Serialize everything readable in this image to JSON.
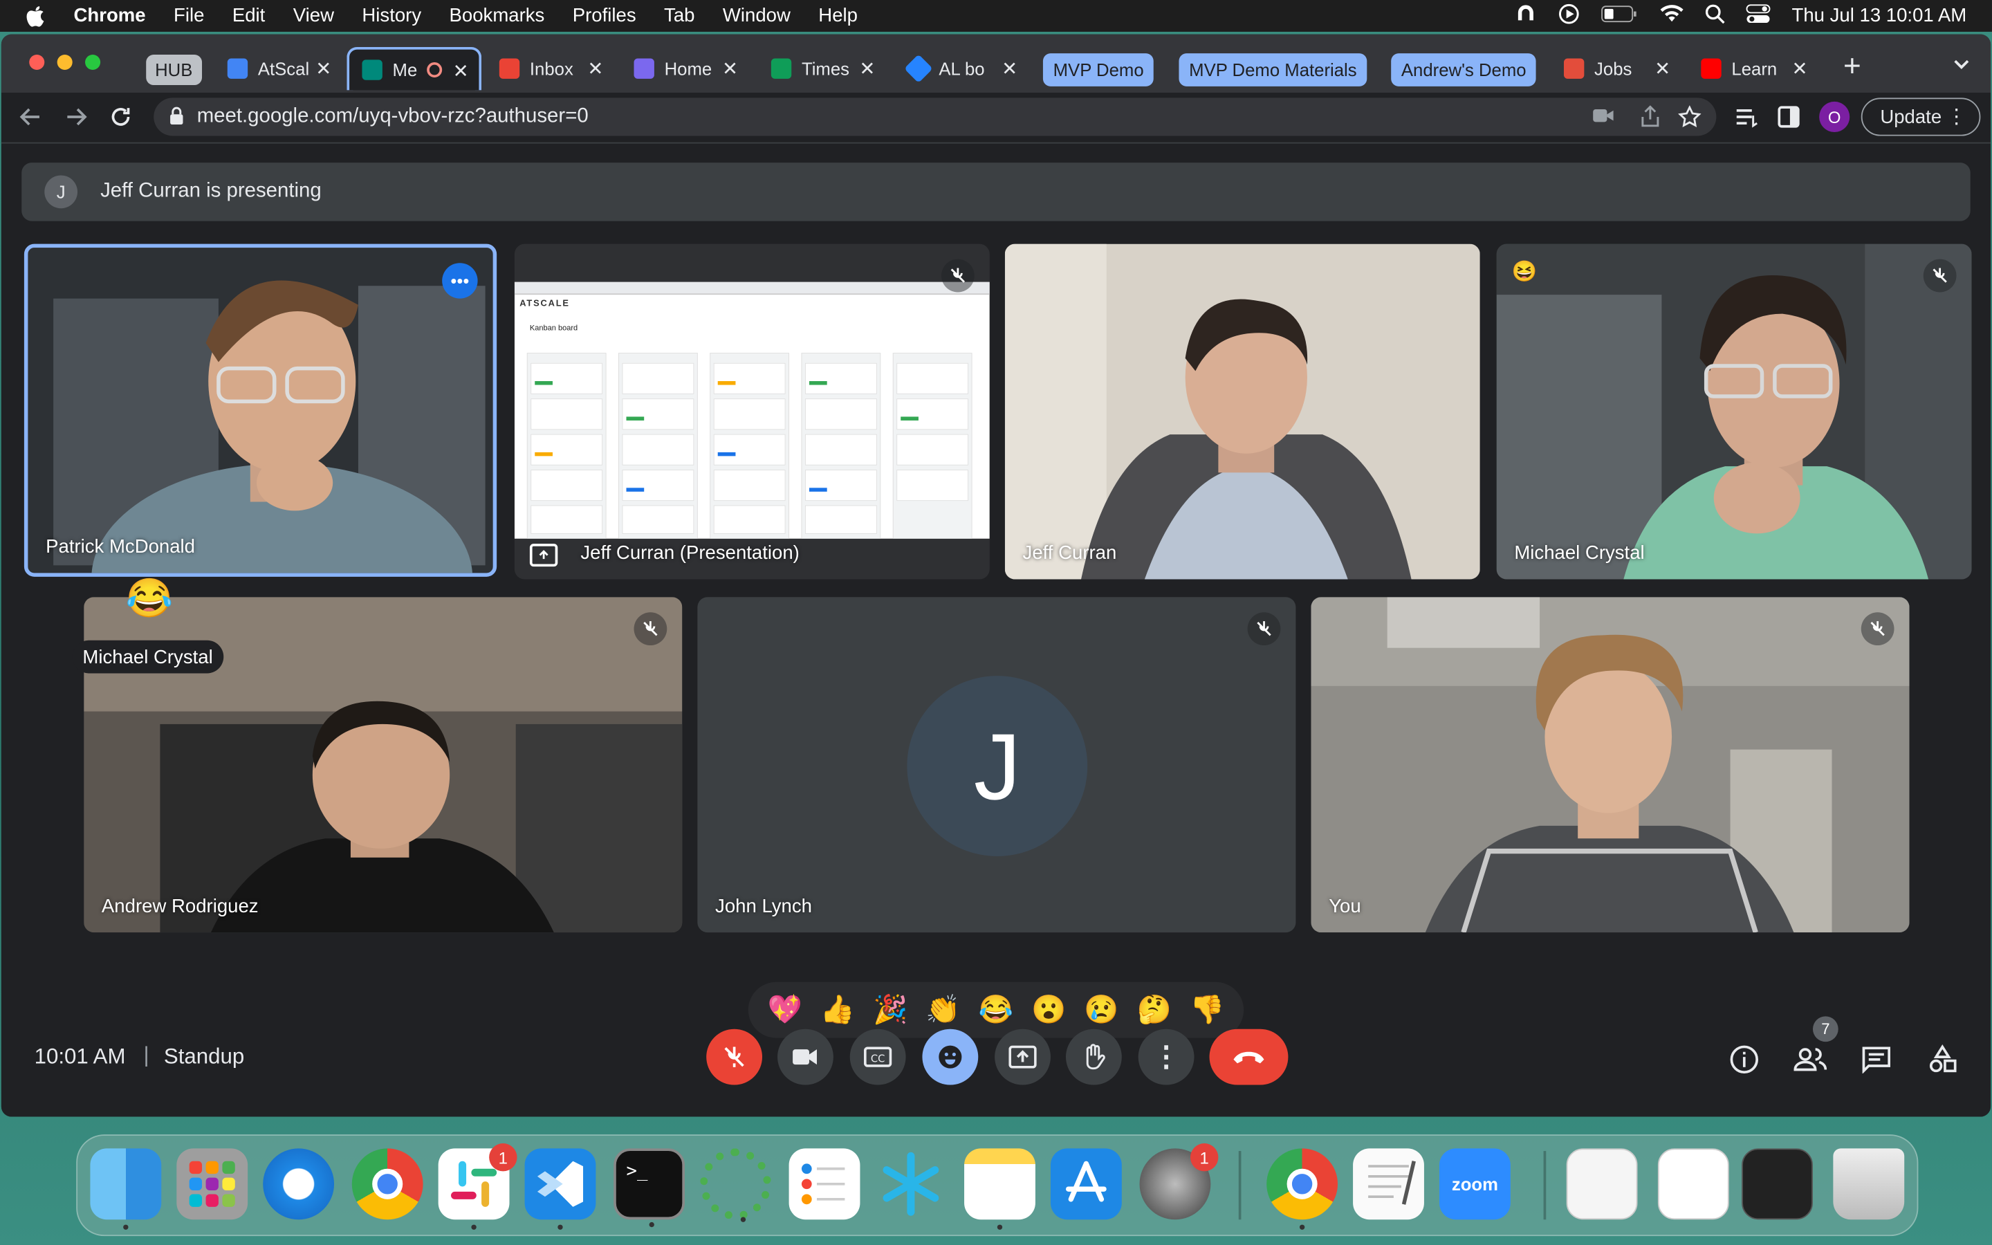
{
  "menubar": {
    "app": "Chrome",
    "items": [
      "File",
      "Edit",
      "View",
      "History",
      "Bookmarks",
      "Profiles",
      "Tab",
      "Window",
      "Help"
    ],
    "clock": "Thu Jul 13  10:01 AM"
  },
  "tabs": {
    "hub": "HUB",
    "items": [
      {
        "label": "AtScal",
        "color": "#4285f4"
      },
      {
        "label": "Me",
        "color": "#00897b"
      },
      {
        "label": "Inbox",
        "color": "#ea4335"
      },
      {
        "label": "Home",
        "color": "#7b68ee"
      },
      {
        "label": "Times",
        "color": "#0f9d58"
      },
      {
        "label": "AL bo",
        "color": "#2684ff"
      }
    ],
    "groups": [
      "MVP Demo",
      "MVP Demo Materials",
      "Andrew's Demo"
    ],
    "after": [
      {
        "label": "Jobs",
        "color": "#e34d3b"
      },
      {
        "label": "Learn",
        "color": "#ff0000"
      }
    ]
  },
  "toolbar": {
    "url": "meet.google.com/uyq-vbov-rzc?authuser=0",
    "profile_initial": "O",
    "update_label": "Update"
  },
  "meet": {
    "presenting_initial": "J",
    "presenting_text": "Jeff Curran is presenting",
    "tiles": {
      "t1": "Patrick McDonald",
      "t2": "Jeff Curran (Presentation)",
      "t3": "Jeff Curran",
      "t4": "Michael Crystal",
      "t5": "Andrew Rodriguez",
      "t6": "John Lynch",
      "t7": "You"
    },
    "reaction_name": "Michael Crystal",
    "john_initial": "J",
    "reactions": [
      "💖",
      "👍",
      "🎉",
      "👏",
      "😂",
      "😮",
      "😢",
      "🤔",
      "👎"
    ],
    "pres_logo": "ATSCALE",
    "pres_board": "Kanban board",
    "time": "10:01 AM",
    "separator": "|",
    "meeting_name": "Standup",
    "people_count": "7"
  },
  "dock": {
    "slack_badge": "1",
    "settings_badge": "1",
    "zoom_label": "zoom"
  },
  "colors": {
    "accent": "#8ab4f8",
    "end_call": "#ea4335"
  }
}
